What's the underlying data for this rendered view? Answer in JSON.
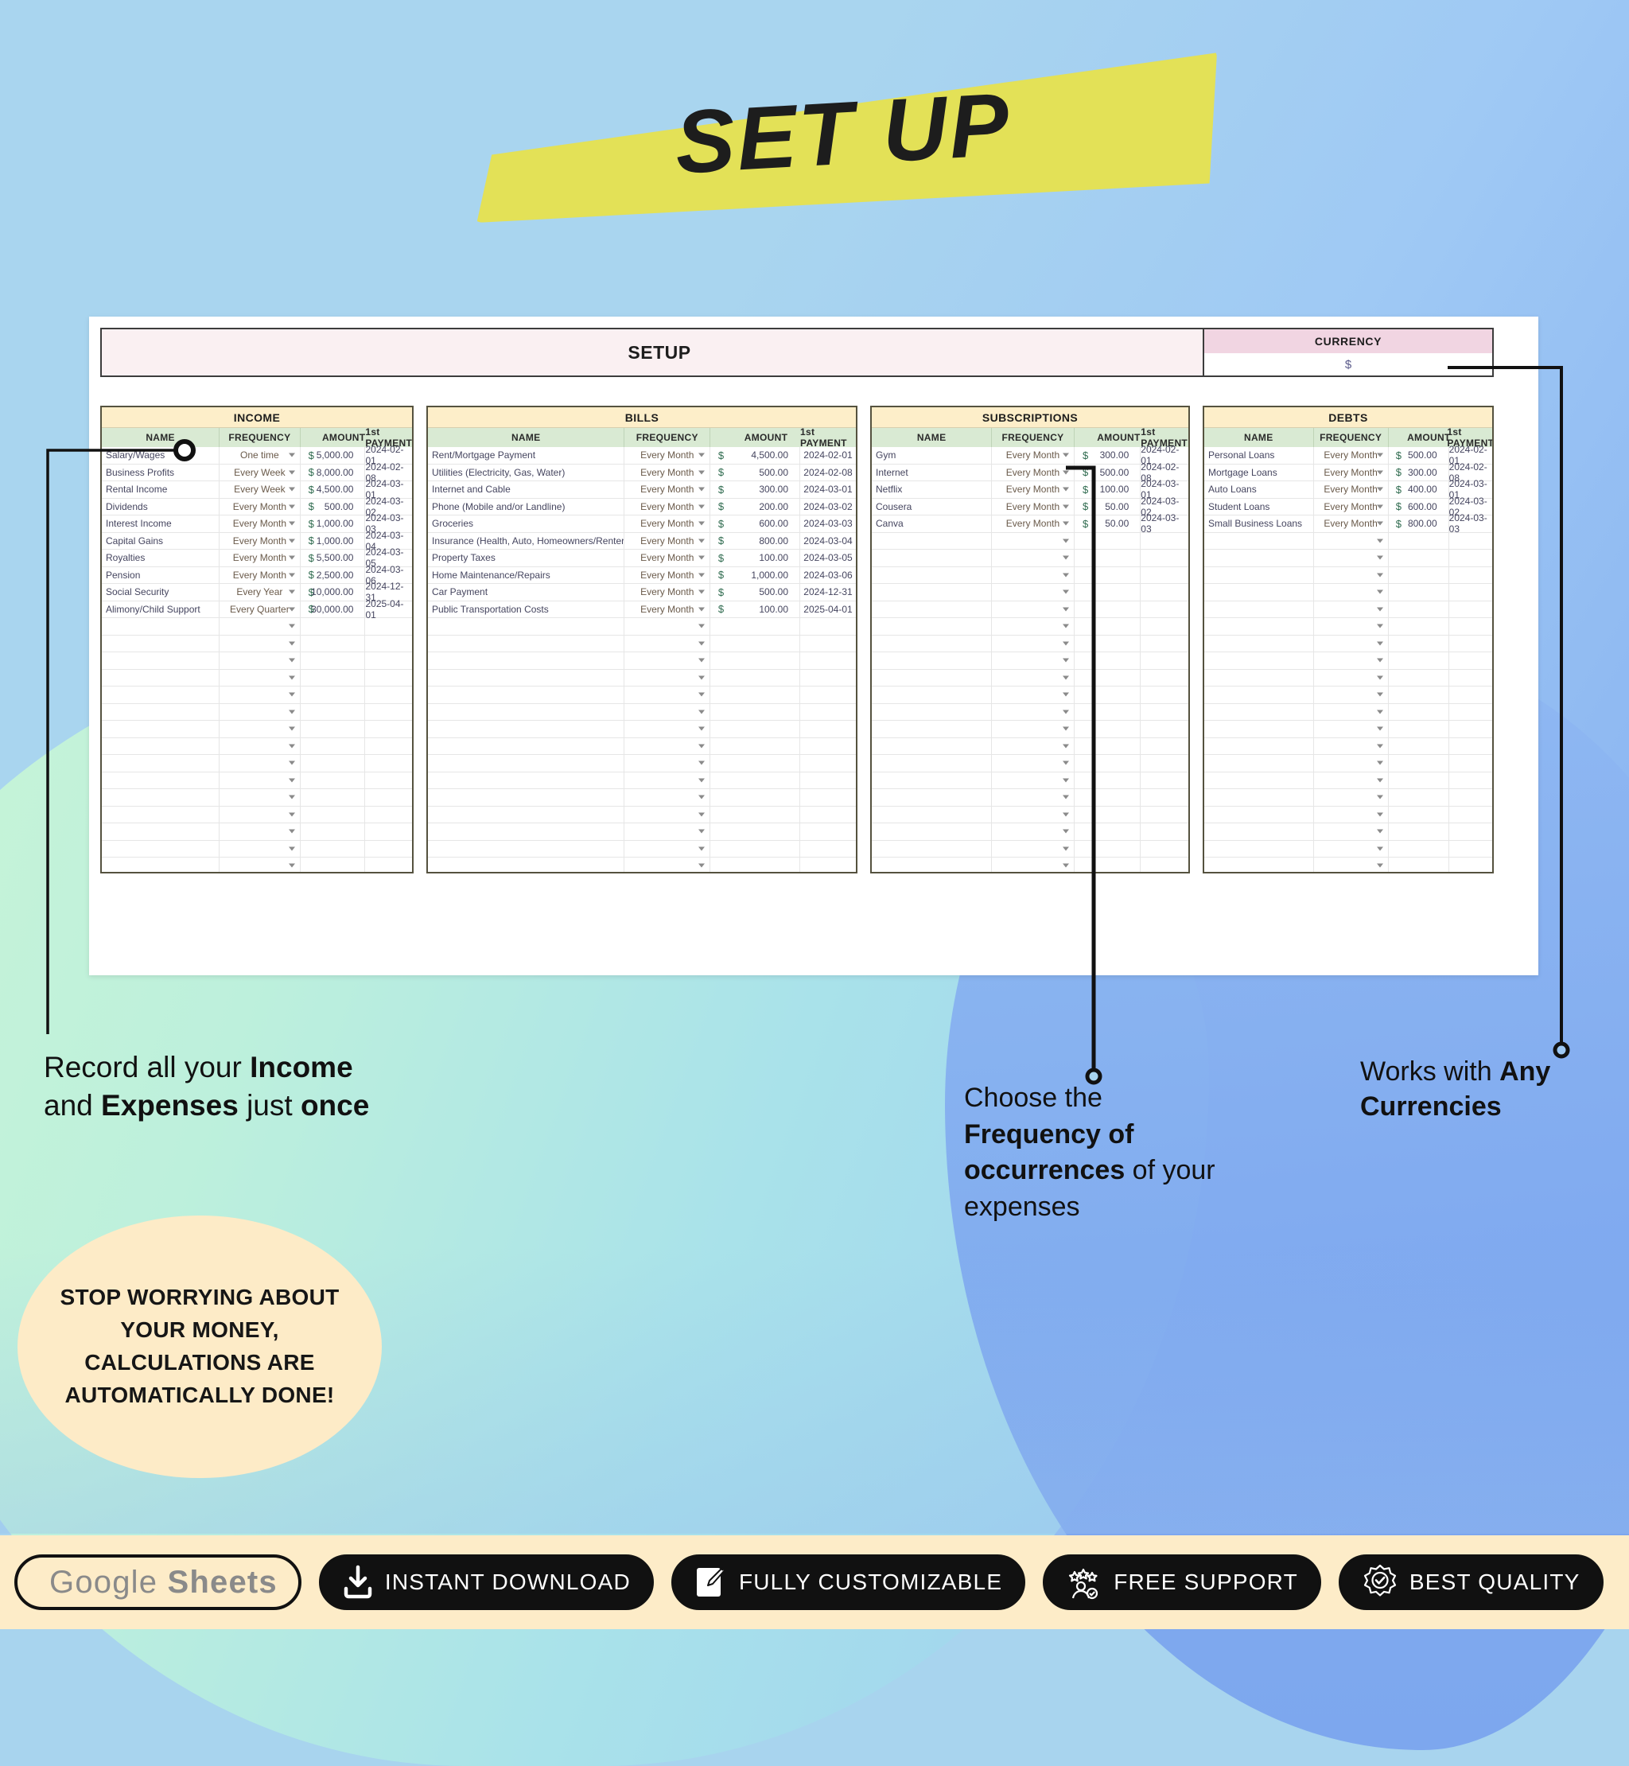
{
  "title": {
    "banner_text": "SET UP"
  },
  "sheet": {
    "setup_header": "SETUP",
    "currency": {
      "label": "CURRENCY",
      "value": "$"
    },
    "columns": {
      "name": "NAME",
      "frequency": "FREQUENCY",
      "amount": "AMOUNT",
      "first_payment": "1st PAYMENT"
    },
    "currency_symbol": "$",
    "tables": [
      {
        "id": "income",
        "title": "INCOME",
        "rows": [
          {
            "name": "Salary/Wages",
            "frequency": "One time",
            "amount": "5,000.00",
            "first_payment": "2024-02-01"
          },
          {
            "name": "Business Profits",
            "frequency": "Every Week",
            "amount": "8,000.00",
            "first_payment": "2024-02-08"
          },
          {
            "name": "Rental Income",
            "frequency": "Every Week",
            "amount": "4,500.00",
            "first_payment": "2024-03-01"
          },
          {
            "name": "Dividends",
            "frequency": "Every Month",
            "amount": "500.00",
            "first_payment": "2024-03-02"
          },
          {
            "name": "Interest Income",
            "frequency": "Every Month",
            "amount": "1,000.00",
            "first_payment": "2024-03-03"
          },
          {
            "name": "Capital Gains",
            "frequency": "Every Month",
            "amount": "1,000.00",
            "first_payment": "2024-03-04"
          },
          {
            "name": "Royalties",
            "frequency": "Every Month",
            "amount": "5,500.00",
            "first_payment": "2024-03-05"
          },
          {
            "name": "Pension",
            "frequency": "Every Month",
            "amount": "2,500.00",
            "first_payment": "2024-03-06"
          },
          {
            "name": "Social Security",
            "frequency": "Every Year",
            "amount": "10,000.00",
            "first_payment": "2024-12-31"
          },
          {
            "name": "Alimony/Child Support",
            "frequency": "Every Quarter",
            "amount": "30,000.00",
            "first_payment": "2025-04-01"
          }
        ]
      },
      {
        "id": "bills",
        "title": "BILLS",
        "rows": [
          {
            "name": "Rent/Mortgage Payment",
            "frequency": "Every Month",
            "amount": "4,500.00",
            "first_payment": "2024-02-01"
          },
          {
            "name": "Utilities (Electricity, Gas, Water)",
            "frequency": "Every Month",
            "amount": "500.00",
            "first_payment": "2024-02-08"
          },
          {
            "name": "Internet and Cable",
            "frequency": "Every Month",
            "amount": "300.00",
            "first_payment": "2024-03-01"
          },
          {
            "name": "Phone (Mobile and/or Landline)",
            "frequency": "Every Month",
            "amount": "200.00",
            "first_payment": "2024-03-02"
          },
          {
            "name": "Groceries",
            "frequency": "Every Month",
            "amount": "600.00",
            "first_payment": "2024-03-03"
          },
          {
            "name": "Insurance (Health, Auto, Homeowners/Renters)",
            "frequency": "Every Month",
            "amount": "800.00",
            "first_payment": "2024-03-04"
          },
          {
            "name": "Property Taxes",
            "frequency": "Every Month",
            "amount": "100.00",
            "first_payment": "2024-03-05"
          },
          {
            "name": "Home Maintenance/Repairs",
            "frequency": "Every Month",
            "amount": "1,000.00",
            "first_payment": "2024-03-06"
          },
          {
            "name": "Car Payment",
            "frequency": "Every Month",
            "amount": "500.00",
            "first_payment": "2024-12-31"
          },
          {
            "name": "Public Transportation Costs",
            "frequency": "Every Month",
            "amount": "100.00",
            "first_payment": "2025-04-01"
          }
        ]
      },
      {
        "id": "subscriptions",
        "title": "SUBSCRIPTIONS",
        "rows": [
          {
            "name": "Gym",
            "frequency": "Every Month",
            "amount": "300.00",
            "first_payment": "2024-02-01"
          },
          {
            "name": "Internet",
            "frequency": "Every Month",
            "amount": "500.00",
            "first_payment": "2024-02-08"
          },
          {
            "name": "Netflix",
            "frequency": "Every Month",
            "amount": "100.00",
            "first_payment": "2024-03-01"
          },
          {
            "name": "Cousera",
            "frequency": "Every Month",
            "amount": "50.00",
            "first_payment": "2024-03-02"
          },
          {
            "name": "Canva",
            "frequency": "Every Month",
            "amount": "50.00",
            "first_payment": "2024-03-03"
          }
        ]
      },
      {
        "id": "debts",
        "title": "DEBTS",
        "rows": [
          {
            "name": "Personal Loans",
            "frequency": "Every Month",
            "amount": "500.00",
            "first_payment": "2024-02-01"
          },
          {
            "name": "Mortgage Loans",
            "frequency": "Every Month",
            "amount": "300.00",
            "first_payment": "2024-02-08"
          },
          {
            "name": "Auto Loans",
            "frequency": "Every Month",
            "amount": "400.00",
            "first_payment": "2024-03-01"
          },
          {
            "name": "Student Loans",
            "frequency": "Every Month",
            "amount": "600.00",
            "first_payment": "2024-03-02"
          },
          {
            "name": "Small Business Loans",
            "frequency": "Every Month",
            "amount": "800.00",
            "first_payment": "2024-03-03"
          }
        ]
      }
    ]
  },
  "callouts": {
    "income": {
      "line1_plain_a": "Record all your ",
      "line1_bold": "Income",
      "line2_plain_a": "and  ",
      "line2_bold_a": "Expenses",
      "line2_plain_b": " just ",
      "line2_bold_b": "once"
    },
    "frequency": {
      "plain_a": "Choose the ",
      "bold_a": "Frequency of occurrences",
      "plain_b": " of your expenses"
    },
    "currency": {
      "plain_a": "Works with ",
      "bold_a": "Any Currencies"
    }
  },
  "badge": {
    "text": "STOP WORRYING ABOUT YOUR MONEY, CALCULATIONS ARE AUTOMATICALLY DONE!"
  },
  "footer": {
    "pills": [
      {
        "id": "google-sheets",
        "label": "Google Sheets",
        "icon": "google-sheets-icon",
        "style": "light"
      },
      {
        "id": "instant-download",
        "label": "INSTANT DOWNLOAD",
        "icon": "download-icon",
        "style": "dark"
      },
      {
        "id": "fully-customizable",
        "label": "FULLY CUSTOMIZABLE",
        "icon": "pencil-edit-icon",
        "style": "dark"
      },
      {
        "id": "free-support",
        "label": "FREE SUPPORT",
        "icon": "support-agent-icon",
        "style": "dark"
      },
      {
        "id": "best-quality",
        "label": "BEST QUALITY",
        "icon": "quality-seal-icon",
        "style": "dark"
      }
    ]
  },
  "colors": {
    "banner": "#e3e157",
    "table_title_bg": "#fdeec9",
    "table_head_bg": "#d9ead3",
    "currency_head_bg": "#f1d5e2",
    "setup_bg": "#faf0f2",
    "badge_bg": "#fdebc7",
    "footer_bg": "#fdecc8"
  }
}
